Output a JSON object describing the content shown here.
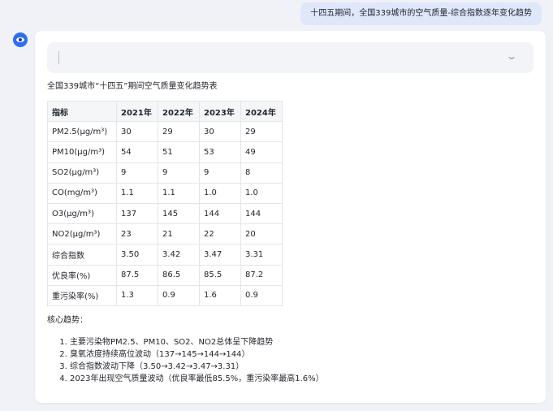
{
  "user_message": "十四五期间，全国339城市的空气质量-综合指数逐年变化趋势",
  "assistant": {
    "table_title": "全国339城市“十四五”期间空气质量变化趋势表",
    "table": {
      "headers": [
        "指标",
        "2021年",
        "2022年",
        "2023年",
        "2024年"
      ],
      "rows": [
        [
          "PM2.5(μg/m³)",
          "30",
          "29",
          "30",
          "29"
        ],
        [
          "PM10(μg/m³)",
          "54",
          "51",
          "53",
          "49"
        ],
        [
          "SO2(μg/m³)",
          "9",
          "9",
          "9",
          "8"
        ],
        [
          "CO(mg/m³)",
          "1.1",
          "1.1",
          "1.0",
          "1.0"
        ],
        [
          "O3(μg/m³)",
          "137",
          "145",
          "144",
          "144"
        ],
        [
          "NO2(μg/m³)",
          "23",
          "21",
          "22",
          "20"
        ],
        [
          "综合指数",
          "3.50",
          "3.42",
          "3.47",
          "3.31"
        ],
        [
          "优良率(%)",
          "87.5",
          "86.5",
          "85.5",
          "87.2"
        ],
        [
          "重污染率(%)",
          "1.3",
          "0.9",
          "1.6",
          "0.9"
        ]
      ]
    },
    "trends_title": "核心趋势：",
    "trends": [
      "主要污染物PM2.5、PM10、SO2、NO2总体呈下降趋势",
      "臭氧浓度持续高位波动（137→145→144→144）",
      "综合指数波动下降（3.50→3.42→3.47→3.31）",
      "2023年出现空气质量波动（优良率最低85.5%，重污染率最高1.6%）"
    ]
  },
  "icons": {
    "avatar": "assistant-eye-avatar-icon",
    "collapse": "chevron-down-icon"
  },
  "colors": {
    "page_background": "#f1f2f7",
    "user_bubble": "#dfe7fb",
    "avatar": "#2f6ef2",
    "table_header": "#f5f6f8"
  }
}
